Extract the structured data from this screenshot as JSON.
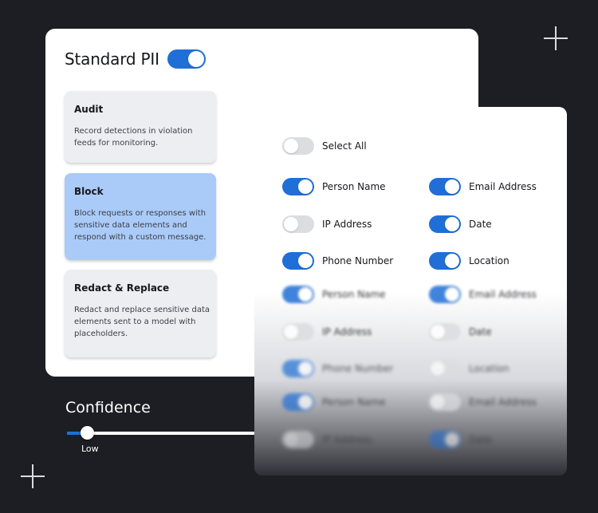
{
  "header": {
    "title": "Standard PII",
    "enabled": true
  },
  "modes": [
    {
      "title": "Audit",
      "description": "Record detections in violation feeds for monitoring.",
      "selected": false
    },
    {
      "title": "Block",
      "description": "Block requests or responses with sensitive data elements and respond with a custom message.",
      "selected": true
    },
    {
      "title": "Redact & Replace",
      "description": "Redact and replace sensitive data elements sent to a model with placeholders.",
      "selected": false
    }
  ],
  "confidence": {
    "label": "Confidence",
    "level_label": "Low",
    "level_fraction": 0.11
  },
  "entities": {
    "select_all": {
      "label": "Select All",
      "on": false
    },
    "items": [
      {
        "label": "Person Name",
        "on": true
      },
      {
        "label": "Email Address",
        "on": true
      },
      {
        "label": "IP Address",
        "on": false
      },
      {
        "label": "Date",
        "on": true
      },
      {
        "label": "Phone Number",
        "on": true
      },
      {
        "label": "Location",
        "on": true
      },
      {
        "label": "Person Name",
        "on": true
      },
      {
        "label": "Email Address",
        "on": true
      },
      {
        "label": "IP Address",
        "on": false
      },
      {
        "label": "Date",
        "on": false
      },
      {
        "label": "Phone Number",
        "on": true
      },
      {
        "label": "Location",
        "on": false
      },
      {
        "label": "Person Name",
        "on": true
      },
      {
        "label": "Email Address",
        "on": false
      },
      {
        "label": "IP Address",
        "on": false
      },
      {
        "label": "Date",
        "on": true
      }
    ]
  },
  "colors": {
    "accent": "#1f6fd6",
    "selected_card": "#aacbf8",
    "background": "#1d1e24"
  }
}
